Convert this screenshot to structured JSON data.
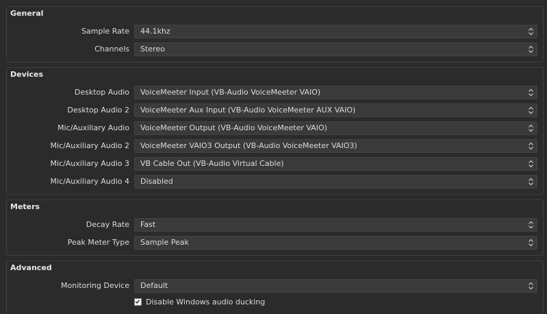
{
  "general": {
    "title": "General",
    "rows": [
      {
        "label": "Sample Rate",
        "value": "44.1khz"
      },
      {
        "label": "Channels",
        "value": "Stereo"
      }
    ]
  },
  "devices": {
    "title": "Devices",
    "rows": [
      {
        "label": "Desktop Audio",
        "value": "VoiceMeeter Input (VB-Audio VoiceMeeter VAIO)"
      },
      {
        "label": "Desktop Audio 2",
        "value": "VoiceMeeter Aux Input (VB-Audio VoiceMeeter AUX VAIO)"
      },
      {
        "label": "Mic/Auxiliary Audio",
        "value": "VoiceMeeter Output (VB-Audio VoiceMeeter VAIO)"
      },
      {
        "label": "Mic/Auxiliary Audio 2",
        "value": "VoiceMeeter VAIO3 Output (VB-Audio VoiceMeeter VAIO3)"
      },
      {
        "label": "Mic/Auxiliary Audio 3",
        "value": "VB Cable Out (VB-Audio Virtual Cable)"
      },
      {
        "label": "Mic/Auxiliary Audio 4",
        "value": "Disabled"
      }
    ]
  },
  "meters": {
    "title": "Meters",
    "rows": [
      {
        "label": "Decay Rate",
        "value": "Fast"
      },
      {
        "label": "Peak Meter Type",
        "value": "Sample Peak"
      }
    ]
  },
  "advanced": {
    "title": "Advanced",
    "rows": [
      {
        "label": "Monitoring Device",
        "value": "Default"
      }
    ],
    "ducking": {
      "label": "Disable Windows audio ducking",
      "checked": true
    }
  },
  "icons": {
    "combo_arrow": "up-down-chevron-icon",
    "checkbox": "checkmark-icon"
  }
}
